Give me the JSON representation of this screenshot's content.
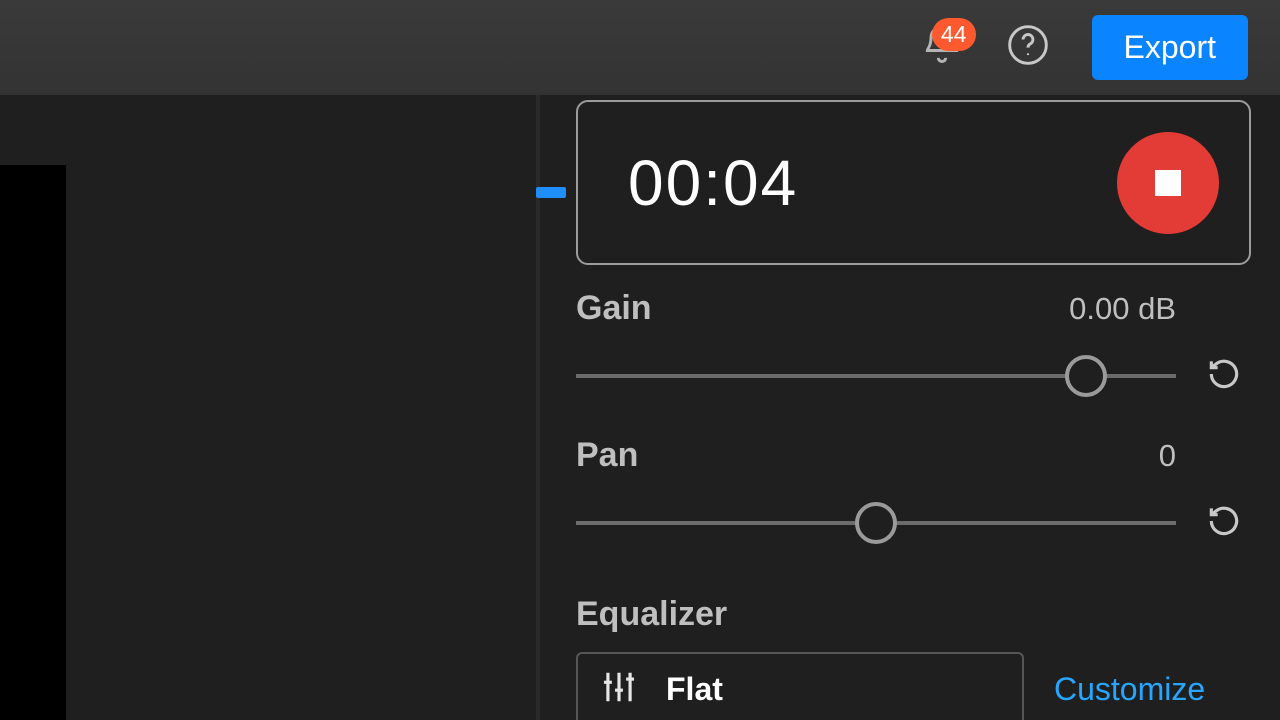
{
  "header": {
    "notification_count": "44",
    "export_label": "Export"
  },
  "recorder": {
    "elapsed_time": "00:04"
  },
  "gain": {
    "label": "Gain",
    "value": "0.00 dB"
  },
  "pan": {
    "label": "Pan",
    "value": "0"
  },
  "equalizer": {
    "label": "Equalizer",
    "preset": "Flat",
    "customize_label": "Customize"
  },
  "colors": {
    "accent": "#0a84ff",
    "record": "#e33b36",
    "badge": "#ff5a2f"
  },
  "slider_positions": {
    "gain_percent": 85,
    "pan_percent": 50
  }
}
